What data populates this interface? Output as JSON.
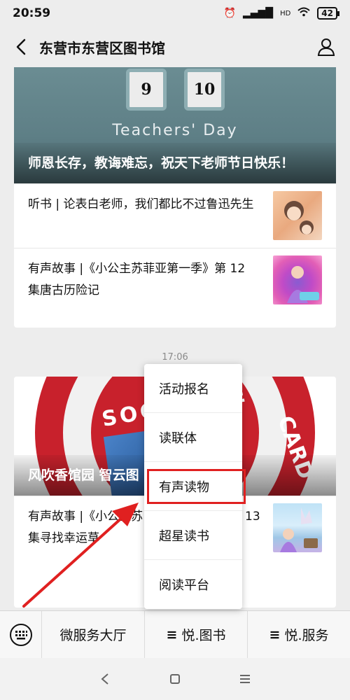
{
  "status_bar": {
    "time": "20:59",
    "battery": "42",
    "network": "HD"
  },
  "header": {
    "title": "东营市东营区图书馆"
  },
  "card1": {
    "date_left": "9",
    "date_right": "10",
    "hero_subtitle": "Teachers' Day",
    "hero_caption": "师恩长存，教诲难忘，祝天下老师节日快乐！",
    "articles": [
      {
        "title": "听书 | 论表白老师，我们都比不过鲁迅先生"
      },
      {
        "title": "有声故事 |《小公主苏菲亚第一季》第 12 集唐古历险记"
      }
    ]
  },
  "timestamp": "17:06",
  "card2": {
    "hero_caption": "风吹香馆园  智云图",
    "seal_text": "SOCIAL SE",
    "seal_card": "CARD",
    "articles": [
      {
        "title": "有声故事 |《小公主苏",
        "suffix": "13",
        "line2": "集寻找幸运草"
      }
    ]
  },
  "popup_menu": {
    "items": [
      "活动报名",
      "读联体",
      "有声读物",
      "超星读书",
      "阅读平台"
    ]
  },
  "bottom_menu": {
    "items": [
      "微服务大厅",
      "悦.图书",
      "悦.服务"
    ],
    "menu_glyph": "≡"
  },
  "colors": {
    "highlight": "#e02020",
    "seal_red": "#c8212c"
  }
}
